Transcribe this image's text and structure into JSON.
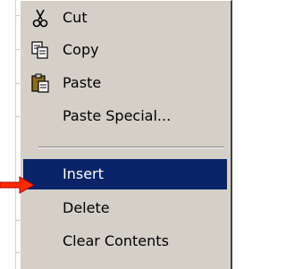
{
  "context_menu": {
    "items": [
      {
        "label": "Cut",
        "icon": "scissors-icon"
      },
      {
        "label": "Copy",
        "icon": "copy-icon"
      },
      {
        "label": "Paste",
        "icon": "paste-icon"
      },
      {
        "label": "Paste Special..."
      },
      {
        "label": "Insert",
        "highlighted": true
      },
      {
        "label": "Delete"
      },
      {
        "label": "Clear Contents"
      }
    ]
  },
  "pointer": {
    "icon": "red-arrow-icon",
    "color": "#ff2a00"
  },
  "colors": {
    "menu_bg": "#d4d0c8",
    "highlight_bg": "#0a246a",
    "highlight_text": "#ffffff"
  }
}
